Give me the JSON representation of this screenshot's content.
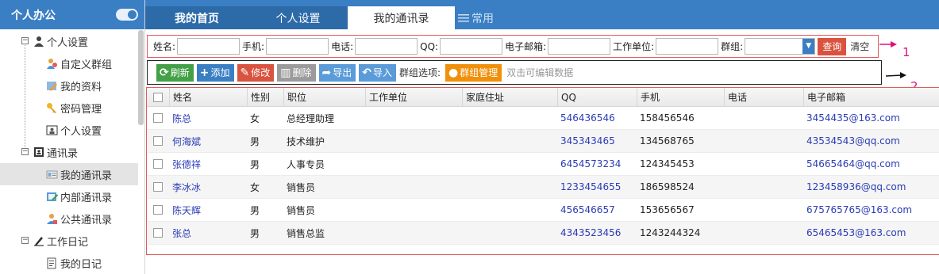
{
  "sidebar": {
    "title": "个人办公",
    "groups": [
      {
        "label": "个人设置",
        "icon": "user-icon",
        "items": [
          {
            "label": "自定义群组",
            "icon": "user-group-icon"
          },
          {
            "label": "我的资料",
            "icon": "profile-icon"
          },
          {
            "label": "密码管理",
            "icon": "key-icon"
          },
          {
            "label": "个人设置",
            "icon": "id-card-icon"
          }
        ]
      },
      {
        "label": "通讯录",
        "icon": "contacts-icon",
        "items": [
          {
            "label": "我的通讯录",
            "icon": "address-card-icon",
            "active": true
          },
          {
            "label": "内部通讯录",
            "icon": "internal-book-icon"
          },
          {
            "label": "公共通讯录",
            "icon": "public-book-icon"
          }
        ]
      },
      {
        "label": "工作日记",
        "icon": "pencil-icon",
        "items": [
          {
            "label": "我的日记",
            "icon": "diary-icon"
          }
        ]
      }
    ]
  },
  "tabs": [
    "我的首页",
    "个人设置",
    "我的通讯录",
    "常用"
  ],
  "search": {
    "name_label": "姓名:",
    "mobile_label": "手机:",
    "phone_label": "电话:",
    "qq_label": "QQ:",
    "email_label": "电子邮箱:",
    "company_label": "工作单位:",
    "group_label": "群组:",
    "query_button": "查询",
    "clear_link": "清空"
  },
  "annotations": {
    "one": "1",
    "two": "2"
  },
  "toolbar": {
    "refresh": "刷新",
    "add": "添加",
    "edit": "修改",
    "delete": "删除",
    "export": "导出",
    "import": "导入",
    "group_options_label": "群组选项:",
    "group_manage": "群组管理",
    "hint": "双击可编辑数据"
  },
  "table": {
    "headers": [
      "姓名",
      "性别",
      "职位",
      "工作单位",
      "家庭住址",
      "QQ",
      "手机",
      "电话",
      "电子邮箱"
    ],
    "rows": [
      {
        "name": "陈总",
        "gender": "女",
        "position": "总经理助理",
        "company": "",
        "address": "",
        "qq": "546436546",
        "mobile": "158456546",
        "phone": "",
        "email": "3454435@163.com"
      },
      {
        "name": "何海斌",
        "gender": "男",
        "position": "技术维护",
        "company": "",
        "address": "",
        "qq": "345343465",
        "mobile": "134568765",
        "phone": "",
        "email": "43534543@qq.com"
      },
      {
        "name": "张德祥",
        "gender": "男",
        "position": "人事专员",
        "company": "",
        "address": "",
        "qq": "6454573234",
        "mobile": "124345453",
        "phone": "",
        "email": "54665464@qq.com"
      },
      {
        "name": "李冰冰",
        "gender": "女",
        "position": "销售员",
        "company": "",
        "address": "",
        "qq": "1233454655",
        "mobile": "186598524",
        "phone": "",
        "email": "123458936@qq.com"
      },
      {
        "name": "陈天辉",
        "gender": "男",
        "position": "销售员",
        "company": "",
        "address": "",
        "qq": "456546657",
        "mobile": "153656567",
        "phone": "",
        "email": "675765765@163.com"
      },
      {
        "name": "张总",
        "gender": "男",
        "position": "销售总监",
        "company": "",
        "address": "",
        "qq": "4343523456",
        "mobile": "1243244324",
        "phone": "",
        "email": "65465453@163.com"
      }
    ]
  },
  "colors": {
    "primary": "#3a7fc3",
    "danger": "#d9533f",
    "success": "#43a047",
    "warning": "#f0900a",
    "annotation": "#e0107a"
  }
}
